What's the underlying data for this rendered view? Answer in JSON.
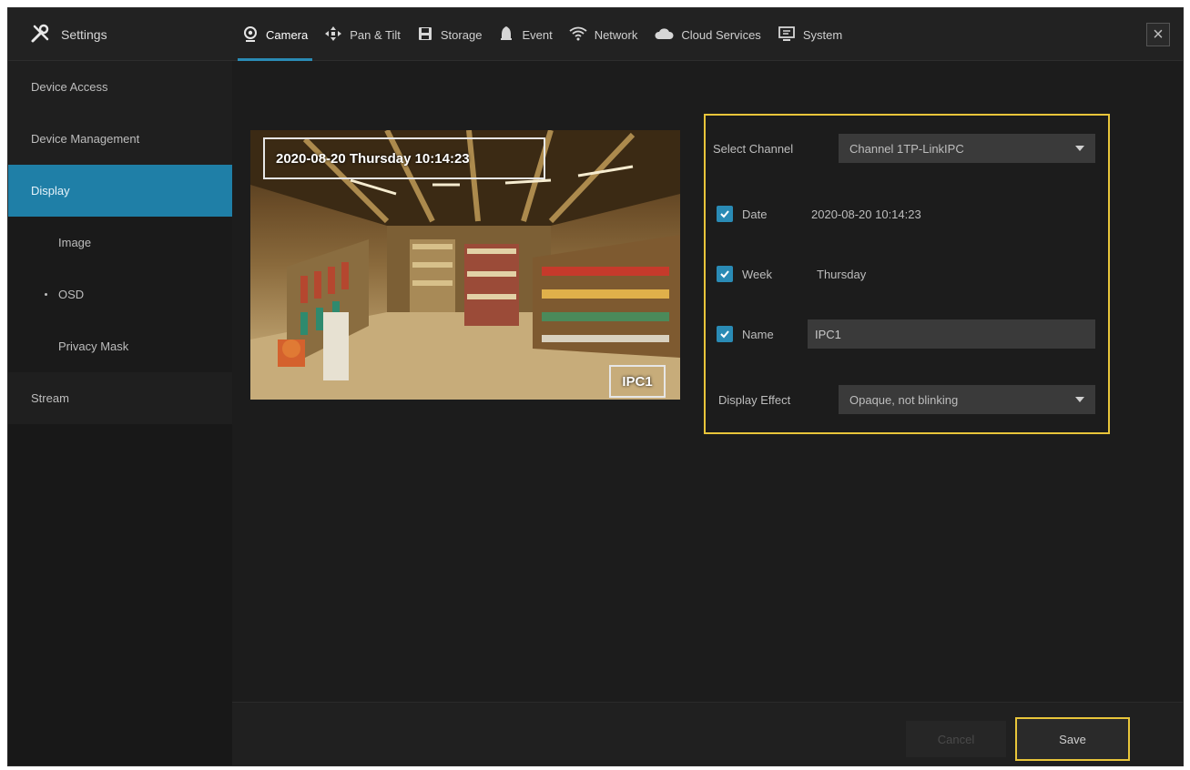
{
  "header": {
    "settings_label": "Settings",
    "tabs": [
      {
        "label": "Camera",
        "icon": "camera-icon",
        "active": true
      },
      {
        "label": "Pan & Tilt",
        "icon": "pan-tilt-icon"
      },
      {
        "label": "Storage",
        "icon": "storage-icon"
      },
      {
        "label": "Event",
        "icon": "event-icon"
      },
      {
        "label": "Network",
        "icon": "network-icon"
      },
      {
        "label": "Cloud Services",
        "icon": "cloud-icon"
      },
      {
        "label": "System",
        "icon": "system-icon"
      }
    ],
    "close_glyph": "×"
  },
  "sidebar": {
    "items": [
      {
        "label": "Device Access"
      },
      {
        "label": "Device Management"
      },
      {
        "label": "Display",
        "active": true
      },
      {
        "label": "Image"
      },
      {
        "label": "OSD",
        "selected": true
      },
      {
        "label": "Privacy Mask"
      },
      {
        "label": "Stream"
      }
    ]
  },
  "preview": {
    "osd_date_text": "2020-08-20 Thursday 10:14:23",
    "osd_name_text": "IPC1"
  },
  "form": {
    "select_channel_label": "Select Channel",
    "select_channel_value": "Channel 1TP-LinkIPC",
    "date_label": "Date",
    "date_value": "2020-08-20 10:14:23",
    "date_checked": true,
    "week_label": "Week",
    "week_value": "Thursday",
    "week_checked": true,
    "name_label": "Name",
    "name_value": "IPC1",
    "name_checked": true,
    "display_effect_label": "Display Effect",
    "display_effect_value": "Opaque, not blinking"
  },
  "footer": {
    "cancel_label": "Cancel",
    "save_label": "Save"
  },
  "colors": {
    "accent": "#1f7fa7",
    "highlight": "#e8c53a",
    "background": "#1c1c1c"
  }
}
